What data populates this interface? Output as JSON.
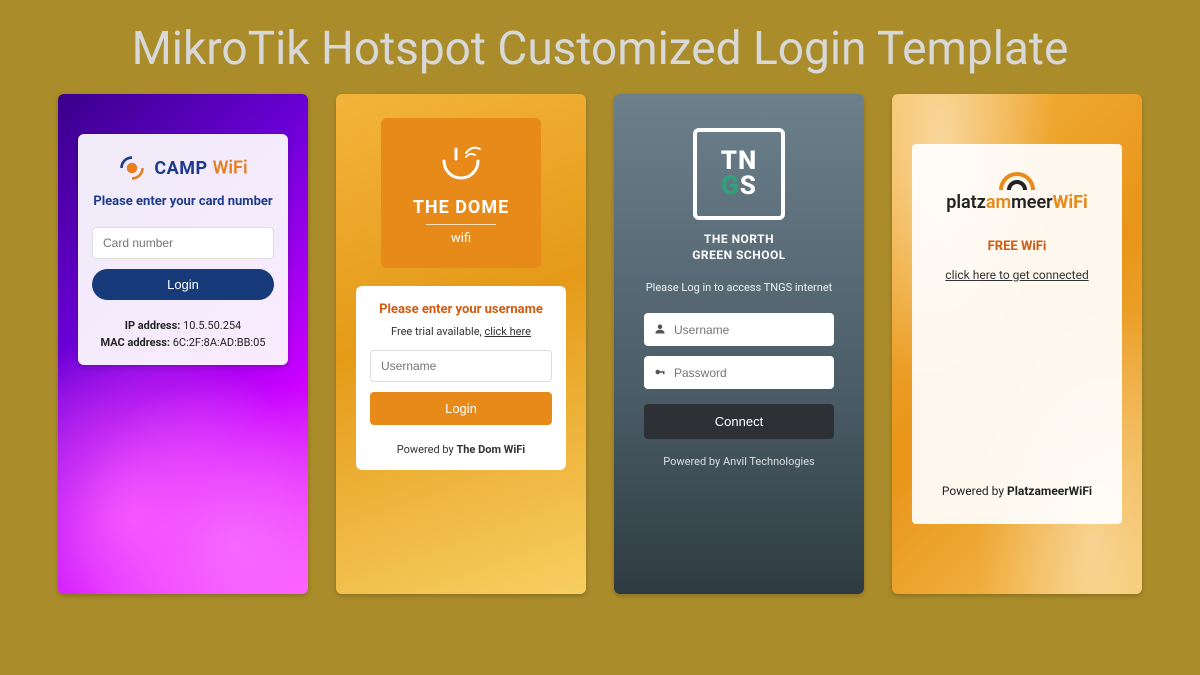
{
  "title": "MikroTik Hotspot Customized Login Template",
  "phones": {
    "camp": {
      "brand_a": "CAMP ",
      "brand_b": "WiFi",
      "prompt": "Please enter your card number",
      "placeholder": "Card number",
      "login": "Login",
      "ip_label": "IP address: ",
      "ip_value": "10.5.50.254",
      "mac_label": "MAC address: ",
      "mac_value": "6C:2F:8A:AD:BB:05"
    },
    "dome": {
      "badge_title": "THE DOME",
      "badge_sub": "wifi",
      "prompt": "Please enter your username",
      "trial_prefix": "Free trial available, ",
      "trial_link": "click here",
      "placeholder": "Username",
      "login": "Login",
      "powered_prefix": "Powered by ",
      "powered_name": "The Dom WiFi"
    },
    "tngs": {
      "logo_line1": "TN",
      "logo_line2_a": "G",
      "logo_line2_b": "S",
      "school_line1": "THE NORTH",
      "school_line2": "GREEN SCHOOL",
      "prompt": "Please Log in to access TNGS internet",
      "user_placeholder": "Username",
      "pass_placeholder": "Password",
      "connect": "Connect",
      "powered": "Powered by Anvil Technologies"
    },
    "platz": {
      "brand_platz": "platz",
      "brand_am": "am",
      "brand_meer": "meer",
      "brand_wifi": "WiFi",
      "free": "FREE WiFi",
      "click": "click here to get connected",
      "powered_prefix": "Powered by ",
      "powered_name": "PlatzameerWiFi"
    }
  }
}
